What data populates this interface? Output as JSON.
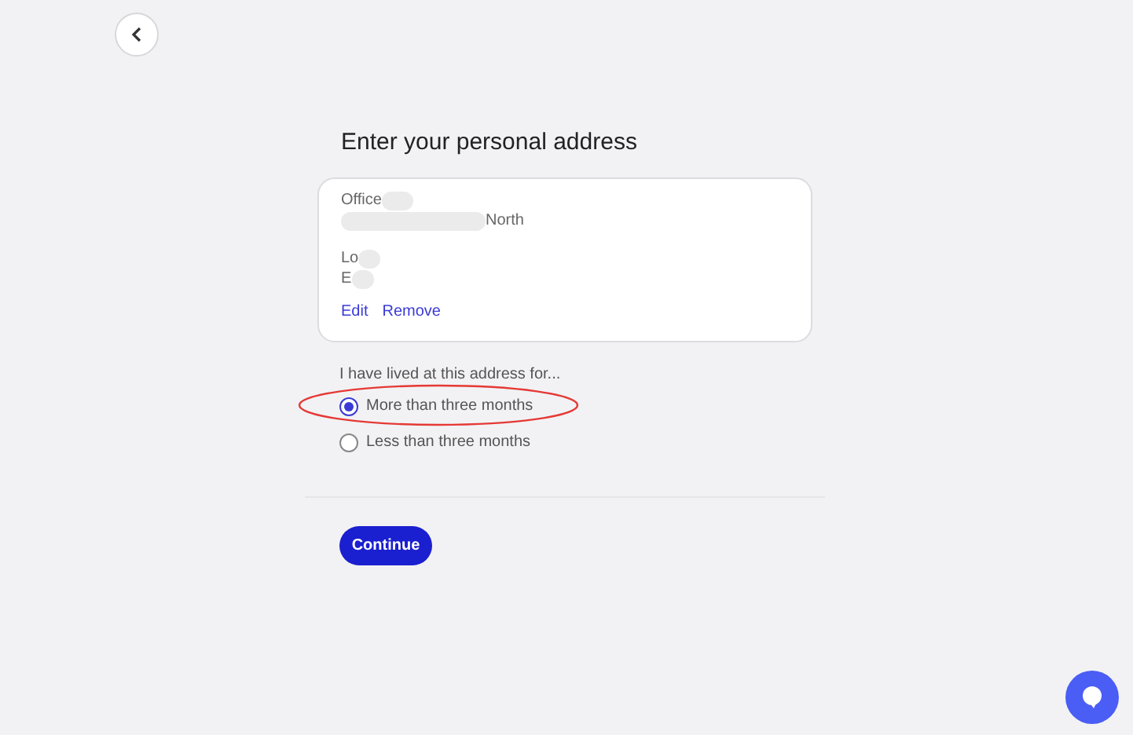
{
  "heading": "Enter your personal address",
  "address_card": {
    "lines": [
      {
        "text": "Office",
        "kind": "blur-after"
      },
      {
        "text": "North",
        "kind": "blur-before"
      },
      {
        "text": "Lo",
        "kind": "blur-after"
      },
      {
        "text": "E",
        "kind": "blur-after"
      }
    ],
    "actions": [
      "Edit",
      "Remove"
    ]
  },
  "duration": {
    "label": "I have lived at this address for...",
    "options": [
      {
        "label": "More than three months",
        "selected": true,
        "highlighted": true
      },
      {
        "label": "Less than three months",
        "selected": false,
        "highlighted": false
      }
    ]
  },
  "continue_button": "Continue"
}
